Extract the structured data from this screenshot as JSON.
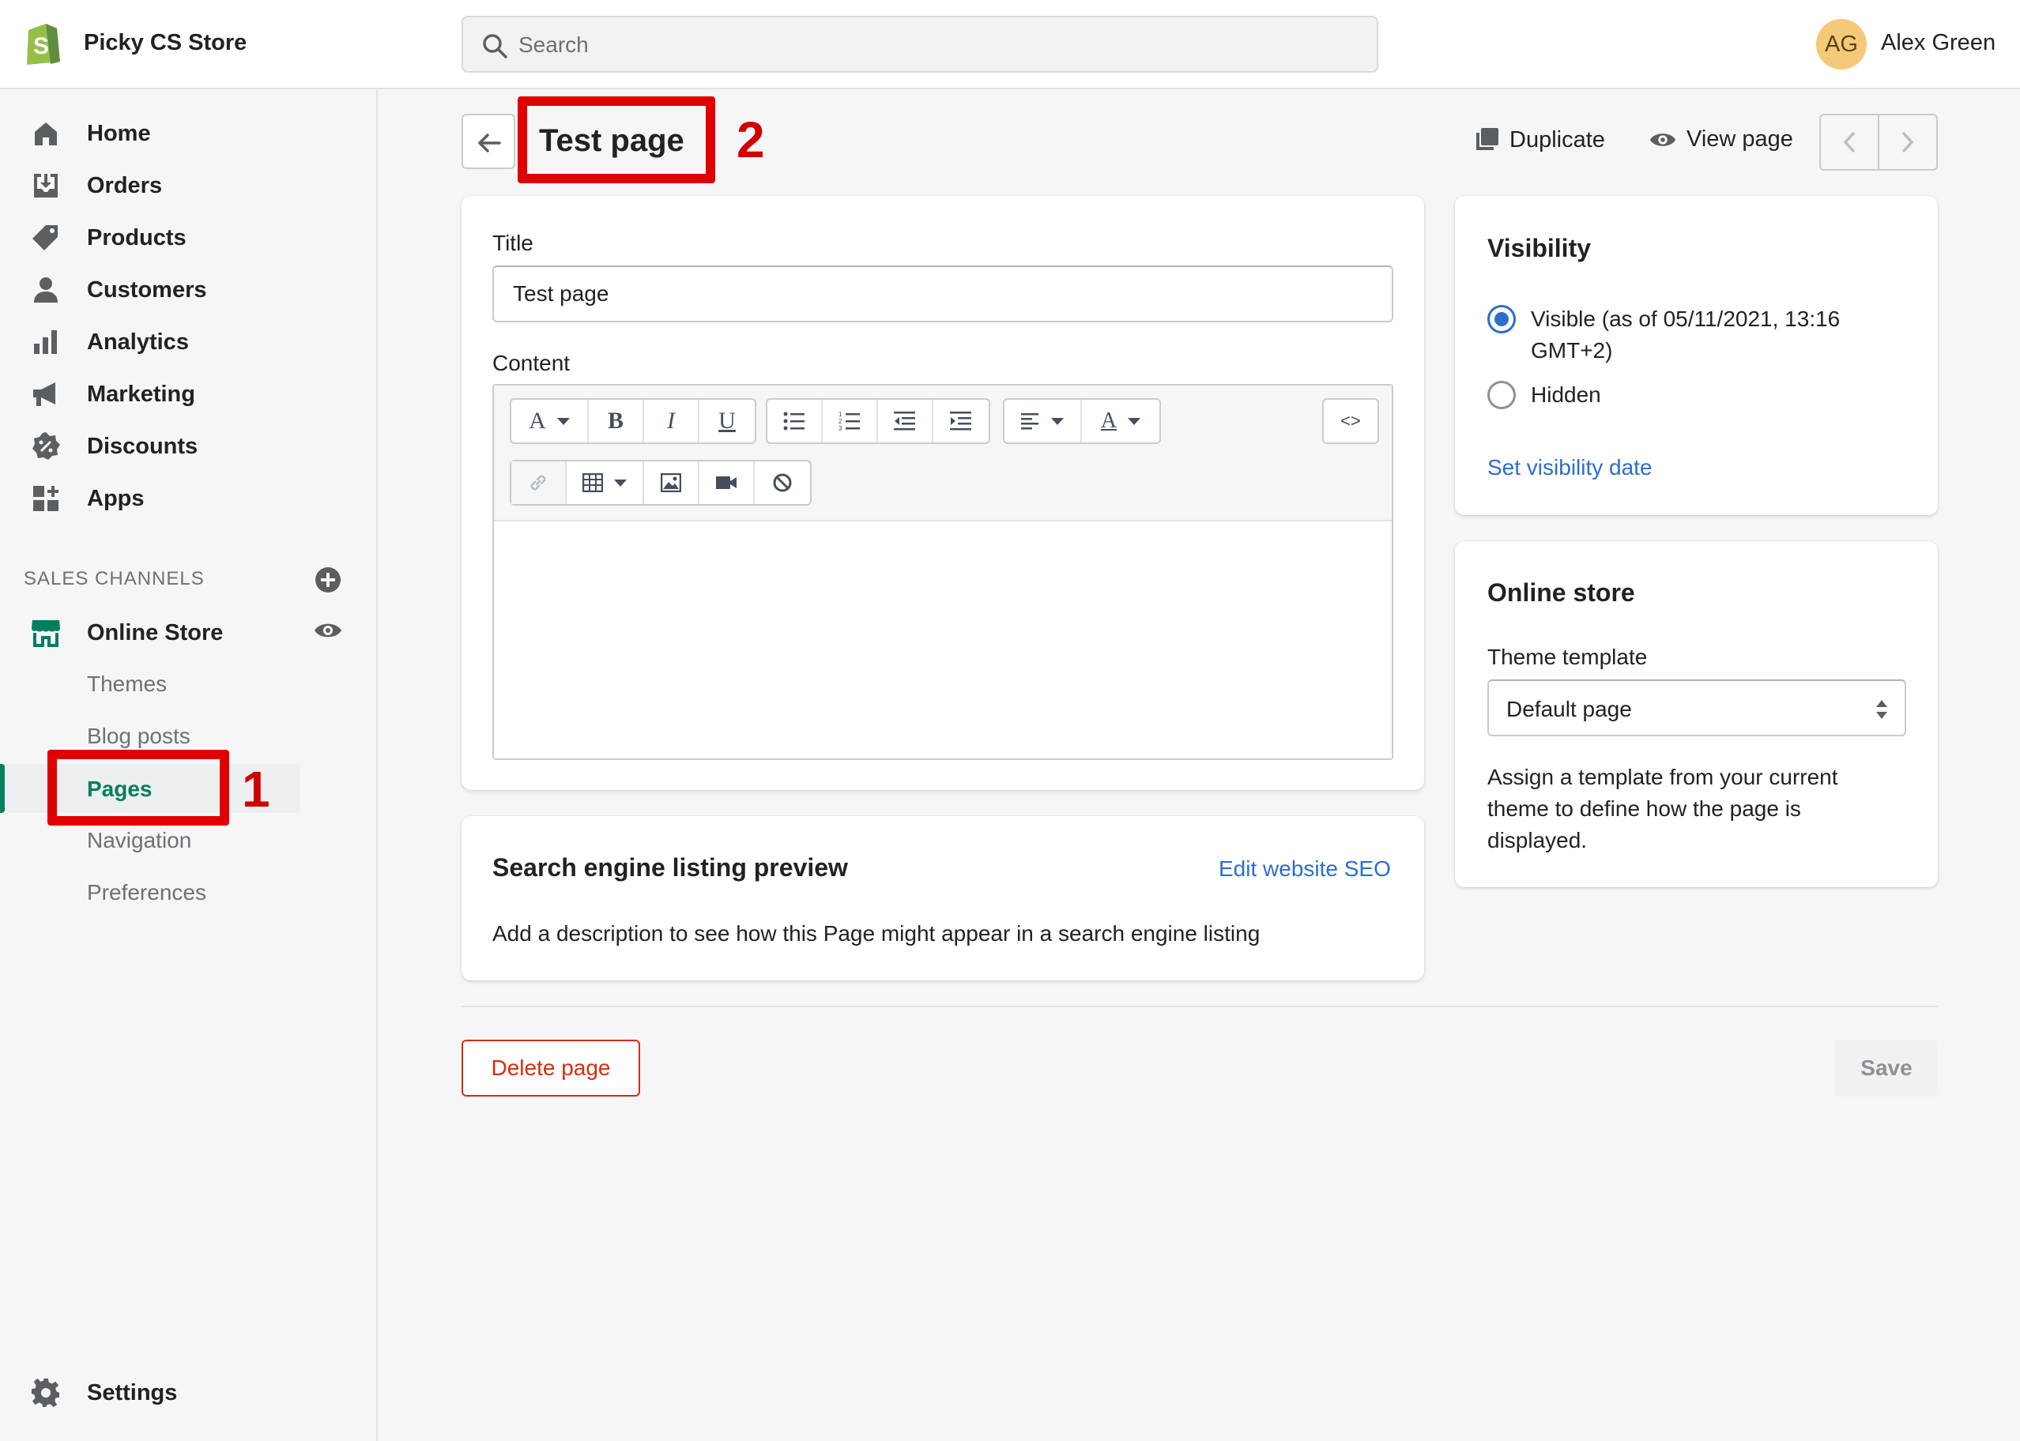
{
  "topbar": {
    "store_name": "Picky CS Store",
    "search_placeholder": "Search",
    "user_initials": "AG",
    "user_name": "Alex Green"
  },
  "sidebar": {
    "items": [
      {
        "label": "Home",
        "icon": "home-icon"
      },
      {
        "label": "Orders",
        "icon": "orders-icon"
      },
      {
        "label": "Products",
        "icon": "tag-icon"
      },
      {
        "label": "Customers",
        "icon": "person-icon"
      },
      {
        "label": "Analytics",
        "icon": "bar-chart-icon"
      },
      {
        "label": "Marketing",
        "icon": "megaphone-icon"
      },
      {
        "label": "Discounts",
        "icon": "discount-icon"
      },
      {
        "label": "Apps",
        "icon": "apps-icon"
      }
    ],
    "section_heading": "SALES CHANNELS",
    "channel": "Online Store",
    "sub_items": [
      "Themes",
      "Blog posts",
      "Pages",
      "Navigation",
      "Preferences"
    ],
    "settings": "Settings"
  },
  "annotations": {
    "one": "1",
    "two": "2"
  },
  "header": {
    "title": "Test page",
    "duplicate": "Duplicate",
    "view_page": "View page"
  },
  "form": {
    "title_label": "Title",
    "title_value": "Test page",
    "content_label": "Content",
    "source_btn": "<>"
  },
  "seo": {
    "title": "Search engine listing preview",
    "edit_link": "Edit website SEO",
    "description": "Add a description to see how this Page might appear in a search engine listing"
  },
  "visibility": {
    "title": "Visibility",
    "visible_line1": "Visible (as of 05/11/2021, 13:16",
    "visible_line2": "GMT+2)",
    "hidden": "Hidden",
    "set_date": "Set visibility date",
    "selected": "visible"
  },
  "online_store": {
    "title": "Online store",
    "template_label": "Theme template",
    "template_value": "Default page",
    "help_line1": "Assign a template from your current",
    "help_line2": "theme to define how the page is",
    "help_line3": "displayed."
  },
  "footer": {
    "delete": "Delete page",
    "save": "Save"
  },
  "colors": {
    "accent_green": "#008060",
    "link_blue": "#2c6ecb",
    "annotation_red": "#e00000",
    "danger_red": "#d72c0d"
  }
}
